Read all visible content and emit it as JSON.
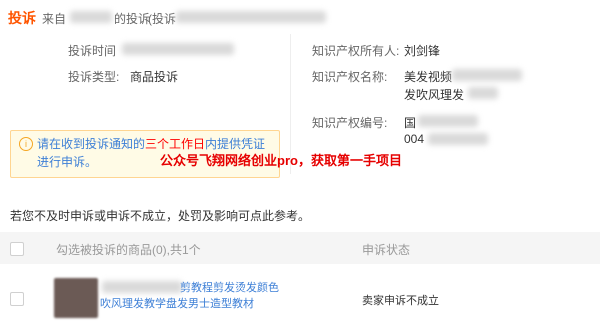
{
  "header": {
    "tag": "投诉",
    "from_prefix": "来自",
    "mid_text": "的投诉",
    "paren_text": "(投诉"
  },
  "left_info": {
    "time_label": "投诉时间",
    "type_label": "投诉类型:",
    "type_value": "商品投诉"
  },
  "right_info": {
    "owner_label": "知识产权所有人:",
    "owner_value": "刘剑锋",
    "name_label": "知识产权名称:",
    "name_value_line1": "美发视频",
    "name_value_line2": "发吹风理发",
    "number_label": "知识产权编号:",
    "number_value_line1": "国",
    "number_value_line2": "004"
  },
  "notice": {
    "icon": "info-icon",
    "text_before": "请在收到投诉通知的",
    "highlight": "三个工作日",
    "text_after": "内提供凭证进行申诉。"
  },
  "watermark": "公众号飞翔网络创业pro，获取第一手项目",
  "info_line": "若您不及时申诉或申诉不成立，处罚及影响可点此参考。",
  "table": {
    "col_product": "勾选被投诉的商品(0),共1个",
    "col_state": "申诉状态",
    "rows": [
      {
        "product_line1": "剪教程剪发烫发颜色",
        "product_line2": "吹风理发教学盘发男士造型教材",
        "state": "卖家申诉不成立"
      }
    ]
  },
  "colors": {
    "accent": "#ff5500",
    "link": "#3d7fd6",
    "highlight": "#ff0000"
  }
}
